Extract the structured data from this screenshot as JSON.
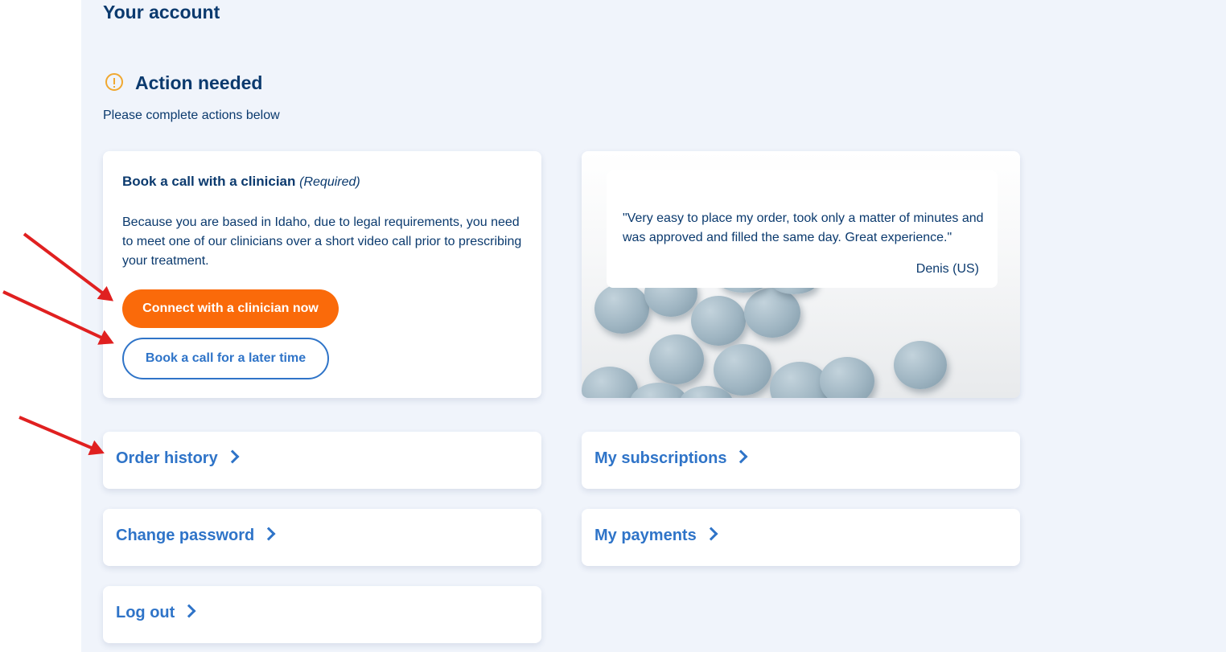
{
  "page": {
    "title": "Your account"
  },
  "action_section": {
    "title": "Action needed",
    "subtitle": "Please complete actions below",
    "icon": "alert-circle-icon",
    "icon_color": "#f0a830"
  },
  "call_card": {
    "title": "Book a call with a clinician",
    "required_label": "(Required)",
    "body": "Because you are based in Idaho, due to legal requirements, you need to meet one of our clinicians over a short video call prior to prescribing your treatment.",
    "primary_button": "Connect with a clinician now",
    "secondary_button": "Book a call for a later time"
  },
  "testimonial": {
    "quote": "\"Very easy to place my order, took only a matter of minutes and was approved and filled the same day. Great experience.\"",
    "author": "Denis (US)"
  },
  "links": {
    "order_history": "Order history",
    "my_subscriptions": "My subscriptions",
    "change_password": "Change password",
    "my_payments": "My payments",
    "log_out": "Log out"
  },
  "colors": {
    "navy_text": "#0b3a6e",
    "link_blue": "#2f74c8",
    "primary_orange": "#fa6a0a",
    "background": "#f0f4fb",
    "annotation_red": "#e02020"
  }
}
